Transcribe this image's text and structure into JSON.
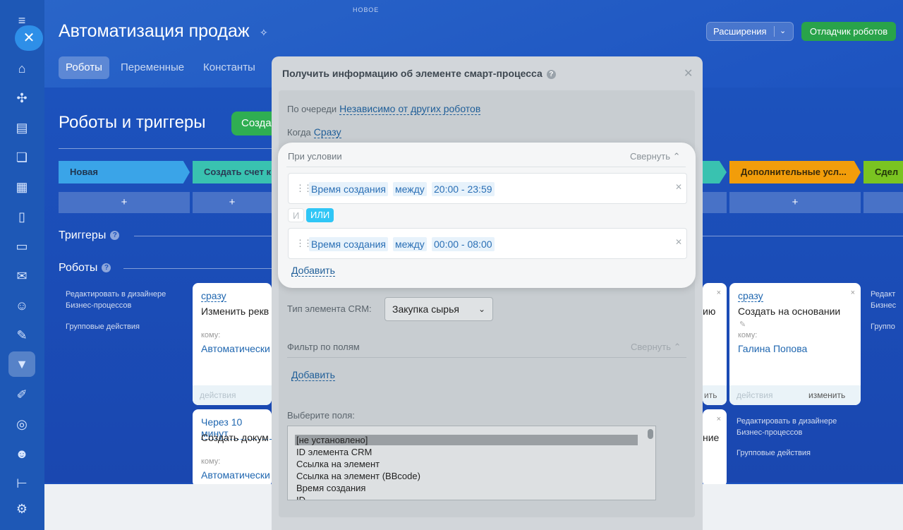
{
  "app": {
    "new_label": "НОВОЕ",
    "title": "Автоматизация продаж",
    "extensions_label": "Расширения",
    "debugger_label": "Отладчик роботов",
    "tabs": [
      {
        "label": "Роботы",
        "active": true
      },
      {
        "label": "Переменные",
        "active": false
      },
      {
        "label": "Константы",
        "active": false
      }
    ],
    "section_title": "Роботы и триггеры",
    "create_label": "Созда",
    "stages": [
      {
        "label": "Новая",
        "color": "#3aa4e8"
      },
      {
        "label": "Создать счет к",
        "color": "#39c2b0"
      },
      {
        "label": "Дополнительные усл...",
        "color": "#f29d0a"
      },
      {
        "label": "Сдел",
        "color": "#7ac421"
      }
    ],
    "plus": "+",
    "triggers_label": "Триггеры",
    "robots_label": "Роботы",
    "side_links": {
      "edit_designer": "Редактировать в дизайнере Бизнес-процессов",
      "group_actions": "Групповые действия",
      "edit_designer_right": "Редакт Бизнес",
      "group_right": "Группо"
    },
    "cards": [
      {
        "when": "сразу",
        "name": "Изменить рекв",
        "to": "кому:",
        "who": "Автоматически",
        "footer": "действия"
      },
      {
        "when": "Через 10 минут",
        "name": "Создать докум",
        "to": "кому:",
        "who": "Автоматически"
      },
      {
        "when": "сразу",
        "name": "Создать на основании",
        "to": "кому:",
        "who": "Галина Попова",
        "footer_left": "действия",
        "footer_right": "изменить"
      }
    ],
    "partial_card_text": "ию",
    "partial_card_footer": "ить",
    "partial_card2_text": "ние",
    "close_x": "×"
  },
  "modal": {
    "title": "Получить информацию об элементе смарт-процесса",
    "queue_label": "По очереди",
    "queue_value": "Независимо от других роботов",
    "when_label": "Когда",
    "when_value": "Сразу",
    "condition_label": "При условии",
    "collapse_label": "Свернуть",
    "conditions": [
      {
        "field": "Время создания",
        "op": "между",
        "value": "20:00 - 23:59"
      },
      {
        "field": "Время создания",
        "op": "между",
        "value": "00:00 - 08:00"
      }
    ],
    "logic_and": "И",
    "logic_or": "ИЛИ",
    "add_label": "Добавить",
    "crm_type_label": "Тип элемента CRM:",
    "crm_type_value": "Закупка сырья",
    "filter_label": "Фильтр по полям",
    "filter_collapse": "Свернуть",
    "filter_add": "Добавить",
    "fields_label": "Выберите поля:",
    "fields": [
      "[не установлено]",
      "ID элемента CRM",
      "Ссылка на элемент",
      "Ссылка на элемент (BBcode)",
      "Время создания",
      "ID"
    ]
  },
  "colors": {
    "accent_green": "#29a34a",
    "link_blue": "#2067b0",
    "or_chip": "#2fc6f6"
  }
}
